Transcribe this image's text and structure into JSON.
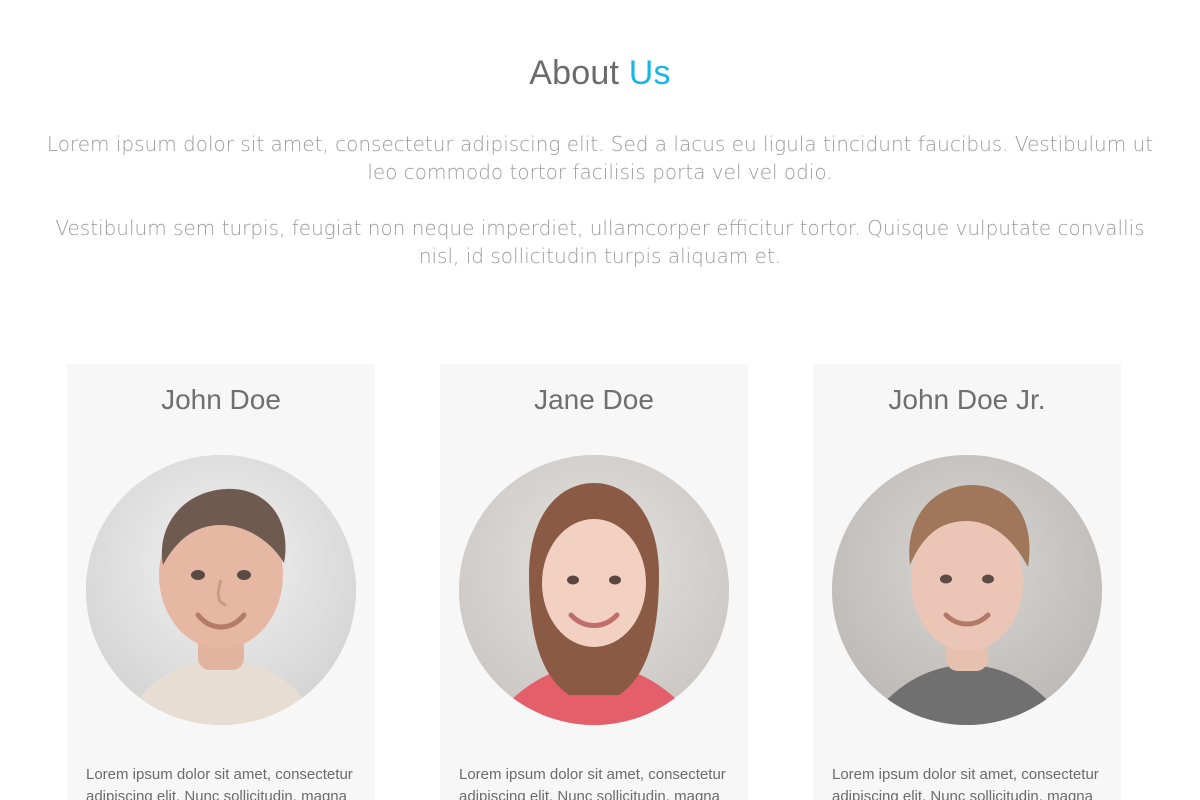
{
  "header": {
    "title_part1": "About ",
    "title_part2": "Us",
    "accent_color": "#18b6e6"
  },
  "intro": {
    "paragraph_1": "Lorem ipsum dolor sit amet, consectetur adipiscing elit. Sed a lacus eu ligula tincidunt faucibus. Vestibulum ut leo commodo tortor facilisis porta vel vel odio.",
    "paragraph_2": "Vestibulum sem turpis, feugiat non neque imperdiet, ullamcorper efficitur tortor. Quisque vulputate convallis nisl, id sollicitudin turpis aliquam et."
  },
  "team": [
    {
      "name": "John Doe",
      "photo": "john-doe-portrait",
      "bio": "Lorem ipsum dolor sit amet, consectetur adipiscing elit. Nunc sollicitudin, magna"
    },
    {
      "name": "Jane Doe",
      "photo": "jane-doe-portrait",
      "bio": "Lorem ipsum dolor sit amet, consectetur adipiscing elit. Nunc sollicitudin, magna"
    },
    {
      "name": "John Doe Jr.",
      "photo": "john-doe-jr-portrait",
      "bio": "Lorem ipsum dolor sit amet, consectetur adipiscing elit. Nunc sollicitudin, magna"
    }
  ]
}
